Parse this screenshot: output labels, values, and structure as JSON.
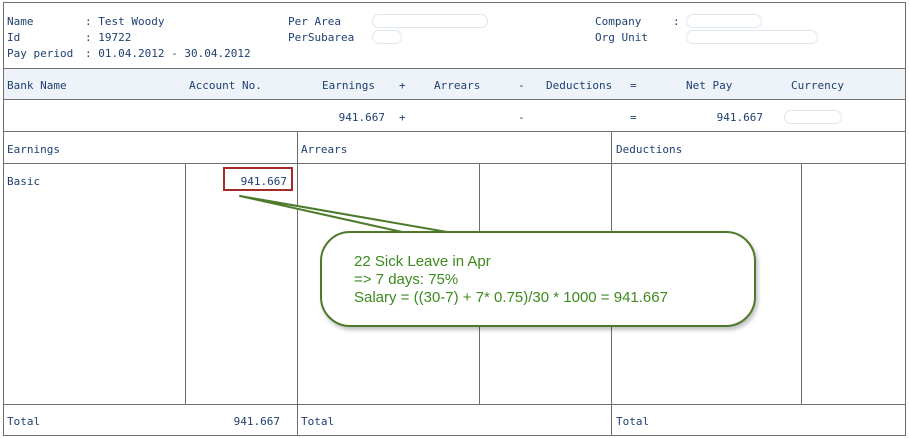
{
  "header": {
    "name_label": "Name",
    "name_value": ": Test Woody",
    "id_label": "Id",
    "id_value": ":    19722",
    "pay_period_label": "Pay period",
    "pay_period_value": ": 01.04.2012   -  30.04.2012",
    "per_area_label": "Per Area",
    "per_subarea_label": "PerSubarea",
    "company_label": "Company",
    "company_colon": ":",
    "org_unit_label": "Org Unit"
  },
  "summary": {
    "headers": {
      "bank_name": "Bank Name",
      "account_no": "Account No.",
      "earnings": "Earnings",
      "plus": "+",
      "arrears": "Arrears",
      "minus": "-",
      "deductions": "Deductions",
      "equals": "=",
      "net_pay": "Net Pay",
      "currency": "Currency"
    },
    "values": {
      "earnings": "941.667",
      "plus": "+",
      "minus": "-",
      "equals": "=",
      "net_pay": "941.667"
    }
  },
  "detail": {
    "earnings_header": "Earnings",
    "arrears_header": "Arrears",
    "deductions_header": "Deductions",
    "rows": [
      {
        "label": "Basic",
        "amount": "941.667"
      }
    ],
    "totals": {
      "earnings_label": "Total",
      "earnings_amount": "941.667",
      "arrears_label": "Total",
      "deductions_label": "Total"
    }
  },
  "annotation": {
    "lines": [
      "22 Sick Leave in Apr",
      "=> 7 days: 75%",
      "Salary = ((30-7) + 7* 0.75)/30 * 1000 = 941.667"
    ],
    "colors": {
      "callout_border": "#4d7a2a",
      "callout_text": "#3d8a1e",
      "highlight_box": "#a52a2a"
    }
  }
}
